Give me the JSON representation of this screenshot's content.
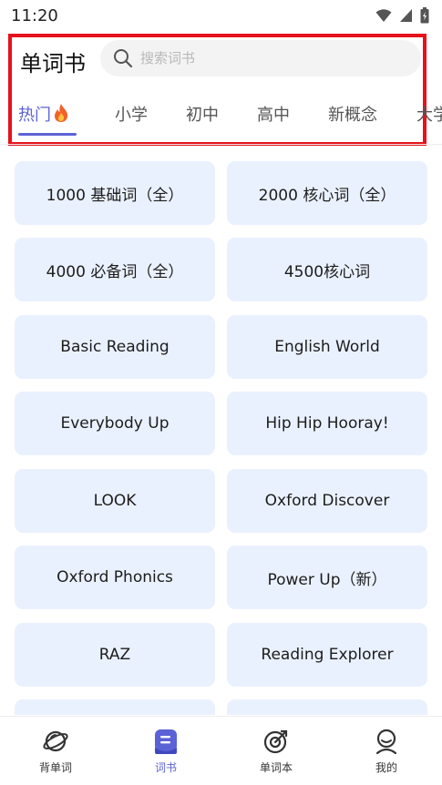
{
  "status_bar": {
    "time": "11:20"
  },
  "header": {
    "title": "单词书",
    "search_placeholder": "搜索词书"
  },
  "tabs": [
    {
      "label": "热门"
    },
    {
      "label": "小学"
    },
    {
      "label": "初中"
    },
    {
      "label": "高中"
    },
    {
      "label": "新概念"
    },
    {
      "label": "大学"
    }
  ],
  "books": [
    {
      "label": "1000 基础词（全）"
    },
    {
      "label": "2000 核心词（全）"
    },
    {
      "label": "4000 必备词（全）"
    },
    {
      "label": "4500核心词"
    },
    {
      "label": "Basic Reading"
    },
    {
      "label": "English World"
    },
    {
      "label": "Everybody Up"
    },
    {
      "label": "Hip Hip Hooray!"
    },
    {
      "label": "LOOK"
    },
    {
      "label": "Oxford Discover"
    },
    {
      "label": "Oxford Phonics"
    },
    {
      "label": "Power Up（新）"
    },
    {
      "label": "RAZ"
    },
    {
      "label": "Reading Explorer"
    },
    {
      "label": ""
    },
    {
      "label": ""
    }
  ],
  "bottom_nav": [
    {
      "label": "背单词",
      "icon": "planet-icon"
    },
    {
      "label": "词书",
      "icon": "book-icon"
    },
    {
      "label": "单词本",
      "icon": "target-icon"
    },
    {
      "label": "我的",
      "icon": "profile-icon"
    }
  ],
  "colors": {
    "accent": "#5b62d6",
    "card_background": "#eaf1fe",
    "highlight_border": "#e5121b",
    "search_background": "#f3f3f3"
  }
}
